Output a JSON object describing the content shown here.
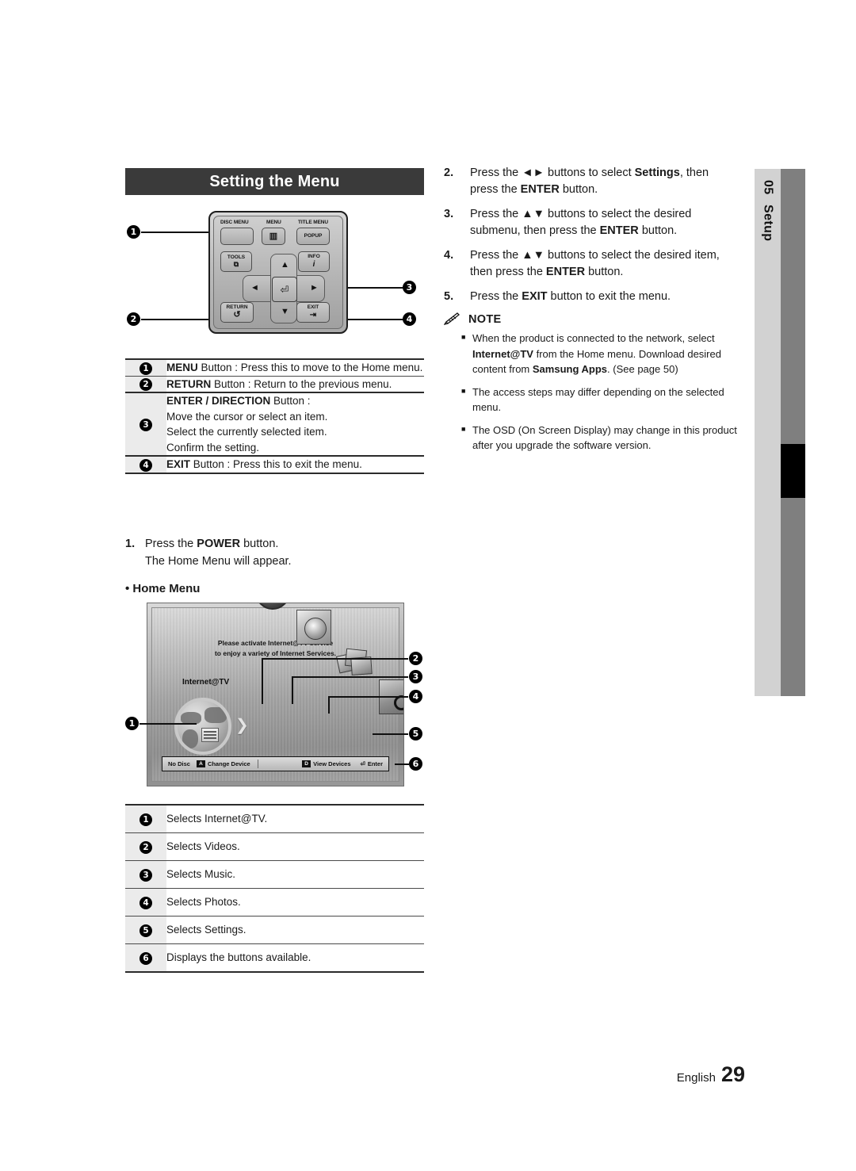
{
  "side_tab": {
    "chapter_number": "05",
    "chapter_label": "Setup"
  },
  "section_title": "Setting the Menu",
  "remote": {
    "labels": {
      "disc_menu": "DISC MENU",
      "menu": "MENU",
      "title_menu": "TITLE MENU",
      "popup": "POPUP",
      "tools": "TOOLS",
      "info": "INFO",
      "info_glyph": "i",
      "return": "RETURN",
      "return_glyph": "↺",
      "exit": "EXIT",
      "tools_glyph": "⧉",
      "menu_glyph": "▥",
      "enter_glyph": "⏎",
      "exit_glyph": "⇥",
      "up": "▲",
      "down": "▼",
      "left": "◄",
      "right": "►"
    },
    "callouts": [
      "1",
      "2",
      "3",
      "4"
    ]
  },
  "button_table": {
    "rows": [
      {
        "num": "1",
        "bold": "MENU",
        "text": " Button : Press this to move to the Home menu.",
        "lines": []
      },
      {
        "num": "2",
        "bold": "RETURN",
        "text": " Button : Return to the previous menu.",
        "lines": []
      },
      {
        "num": "3",
        "bold": "ENTER / DIRECTION",
        "text": " Button :",
        "lines": [
          "Move the cursor or select an item.",
          "Select the currently selected item.",
          "Confirm the setting."
        ]
      },
      {
        "num": "4",
        "bold": "EXIT",
        "text": " Button : Press this to exit the menu.",
        "lines": []
      }
    ]
  },
  "left_steps": {
    "step1_num": "1.",
    "step1_pre": "Press the ",
    "step1_bold": "POWER",
    "step1_post": " button.",
    "step1_line2": "The Home Menu will appear.",
    "home_menu_heading": "• Home Menu"
  },
  "home_menu_screen": {
    "message_line1": "Please activate Internet@TV service",
    "message_line2": "to enjoy a variety of Internet Services.",
    "brand": "Internet@TV",
    "status_bar": {
      "no_disc": "No Disc",
      "key_a": "A",
      "change_device": "Change Device",
      "key_d": "D",
      "view_devices": "View Devices",
      "enter_glyph": "⏎",
      "enter": "Enter"
    },
    "callouts": [
      "1",
      "2",
      "3",
      "4",
      "5",
      "6"
    ]
  },
  "home_menu_table": {
    "rows": [
      {
        "num": "1",
        "text": "Selects Internet@TV."
      },
      {
        "num": "2",
        "text": "Selects Videos."
      },
      {
        "num": "3",
        "text": "Selects Music."
      },
      {
        "num": "4",
        "text": "Selects Photos."
      },
      {
        "num": "5",
        "text": "Selects Settings."
      },
      {
        "num": "6",
        "text": "Displays the buttons available."
      }
    ]
  },
  "right_steps": [
    {
      "num": "2.",
      "parts": [
        {
          "t": "Press the ",
          "b": false
        },
        {
          "t": "◄►",
          "b": false
        },
        {
          "t": " buttons to select ",
          "b": false
        },
        {
          "t": "Settings",
          "b": true
        },
        {
          "t": ", then press the ",
          "b": false
        },
        {
          "t": "ENTER",
          "b": true
        },
        {
          "t": " button.",
          "b": false
        }
      ]
    },
    {
      "num": "3.",
      "parts": [
        {
          "t": "Press the ",
          "b": false
        },
        {
          "t": "▲▼",
          "b": false
        },
        {
          "t": " buttons to select the desired submenu, then press the ",
          "b": false
        },
        {
          "t": "ENTER",
          "b": true
        },
        {
          "t": " button.",
          "b": false
        }
      ]
    },
    {
      "num": "4.",
      "parts": [
        {
          "t": "Press the ",
          "b": false
        },
        {
          "t": "▲▼",
          "b": false
        },
        {
          "t": " buttons to select the desired item, then press the ",
          "b": false
        },
        {
          "t": "ENTER",
          "b": true
        },
        {
          "t": " button.",
          "b": false
        }
      ]
    },
    {
      "num": "5.",
      "parts": [
        {
          "t": "Press the ",
          "b": false
        },
        {
          "t": "EXIT",
          "b": true
        },
        {
          "t": " button to exit the menu.",
          "b": false
        }
      ]
    }
  ],
  "note": {
    "heading": "NOTE",
    "items": [
      {
        "parts": [
          {
            "t": "When the product is connected to the network, select ",
            "b": false
          },
          {
            "t": "Internet@TV",
            "b": true
          },
          {
            "t": " from the Home menu. Download desired content from ",
            "b": false
          },
          {
            "t": "Samsung Apps",
            "b": true
          },
          {
            "t": ". (See page 50)",
            "b": false
          }
        ]
      },
      {
        "parts": [
          {
            "t": "The access steps may differ depending on the selected menu.",
            "b": false
          }
        ]
      },
      {
        "parts": [
          {
            "t": "The OSD (On Screen Display) may change in this product after you upgrade the software version.",
            "b": false
          }
        ]
      }
    ]
  },
  "footer": {
    "language": "English",
    "page": "29"
  }
}
